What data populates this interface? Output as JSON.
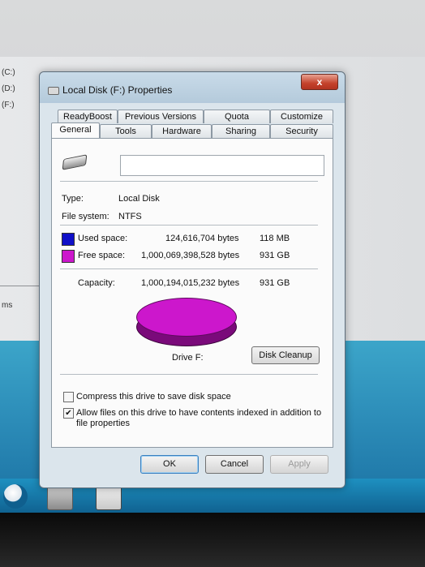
{
  "background": {
    "explorer_drives": [
      "(C:)",
      "(D:)",
      "(F:)"
    ],
    "explorer_status_text": "ms"
  },
  "dialog": {
    "title": "Local Disk (F:) Properties",
    "close_label": "x",
    "tabs_row1": [
      "ReadyBoost",
      "Previous Versions",
      "Quota",
      "Customize"
    ],
    "tabs_row2": [
      "General",
      "Tools",
      "Hardware",
      "Sharing",
      "Security"
    ],
    "active_tab": "General",
    "general": {
      "name_value": "",
      "type_label": "Type:",
      "type_value": "Local Disk",
      "fs_label": "File system:",
      "fs_value": "NTFS",
      "used_label": "Used space:",
      "used_bytes": "124,616,704 bytes",
      "used_size": "118 MB",
      "used_color": "#1010c8",
      "free_label": "Free space:",
      "free_bytes": "1,000,069,398,528 bytes",
      "free_size": "931 GB",
      "free_color": "#cc17cc",
      "capacity_label": "Capacity:",
      "capacity_bytes": "1,000,194,015,232 bytes",
      "capacity_size": "931 GB",
      "drive_label": "Drive F:",
      "disk_cleanup_label": "Disk Cleanup",
      "compress_label": "Compress this drive to save disk space",
      "compress_checked": false,
      "index_label_line1": "Allow files on this drive to have contents indexed in addition to",
      "index_label_line2": "file properties",
      "index_checked": true
    },
    "buttons": {
      "ok": "OK",
      "cancel": "Cancel",
      "apply": "Apply"
    }
  }
}
